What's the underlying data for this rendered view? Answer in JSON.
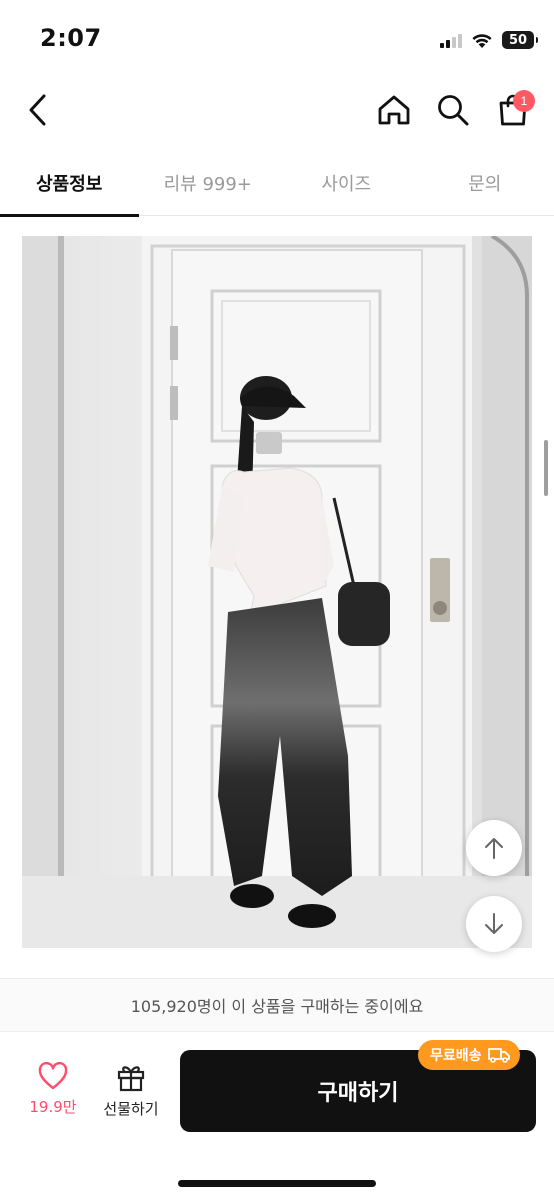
{
  "status_bar": {
    "time": "2:07",
    "battery": "50",
    "icons": [
      "signal-icon",
      "wifi-icon",
      "battery-icon"
    ]
  },
  "header": {
    "icons": [
      "back-chevron-icon",
      "home-icon",
      "search-icon",
      "shopping-bag-icon"
    ],
    "cart_badge": "1",
    "cart_badge_color": "#ff5964"
  },
  "tabs": [
    {
      "label": "상품정보",
      "active": true
    },
    {
      "label": "리뷰 999+",
      "active": false
    },
    {
      "label": "사이즈",
      "active": false
    },
    {
      "label": "문의",
      "active": false
    }
  ],
  "product_image": {
    "description_icon": "product-photo"
  },
  "float_buttons": {
    "up_icon": "arrow-up-icon",
    "down_icon": "arrow-down-icon"
  },
  "purchase_counter": "105,920명이 이 상품을 구매하는 중이에요",
  "bottom_bar": {
    "like_count": "19.9만",
    "gift_label": "선물하기",
    "buy_label": "구매하기",
    "free_shipping_badge": "무료배송",
    "accent_color": "#ff4d6d",
    "badge_color": "#ff9a1f",
    "button_color": "#111111"
  }
}
